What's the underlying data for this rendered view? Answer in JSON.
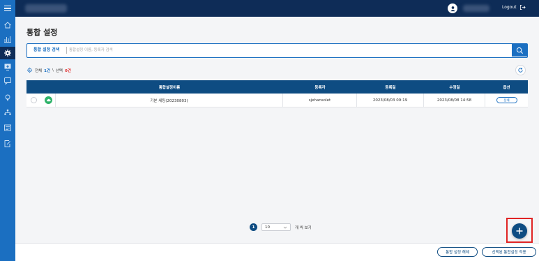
{
  "header": {
    "logout_label": "Logout"
  },
  "sidebar": {
    "items": [
      {
        "icon": "home-icon"
      },
      {
        "icon": "bar-chart-icon"
      },
      {
        "icon": "gear-icon",
        "active": true
      },
      {
        "icon": "monitor-download-icon"
      },
      {
        "icon": "chat-icon"
      },
      {
        "icon": "lightbulb-icon"
      },
      {
        "icon": "network-icon"
      },
      {
        "icon": "list-icon"
      },
      {
        "icon": "edit-document-icon"
      }
    ]
  },
  "page": {
    "title": "통합 설정"
  },
  "search": {
    "label": "통합 설정 검색",
    "placeholder": "통합설정 이름, 등록자 검색"
  },
  "summary": {
    "total_prefix": "전체",
    "total_value": "1건",
    "separator": "\\",
    "selected_prefix": "선택",
    "selected_value": "0건"
  },
  "table": {
    "columns": [
      "통합설정이름",
      "등록자",
      "등록일",
      "수정일",
      "옵션"
    ],
    "rows": [
      {
        "name": "기본 세팅(20230803)",
        "registrant": "sjehansolet",
        "registered": "2023/08/03 09:19",
        "modified": "2023/08/08 14:58",
        "option_label": "상세"
      }
    ]
  },
  "pagination": {
    "current_page": "1",
    "page_size": "10",
    "page_size_suffix": "개 씩 보기"
  },
  "footer": {
    "release_label": "통합 설정 해제",
    "apply_label": "선택된 통합설정 적용"
  },
  "colors": {
    "header_bg": "#0e2c57",
    "sidebar_bg": "#1b6fc1",
    "table_header_bg": "#0e4c82",
    "accent": "#1b6fc1",
    "selected_count": "#e03131",
    "status_online": "#2fb36a",
    "highlight_border": "#e02424"
  }
}
